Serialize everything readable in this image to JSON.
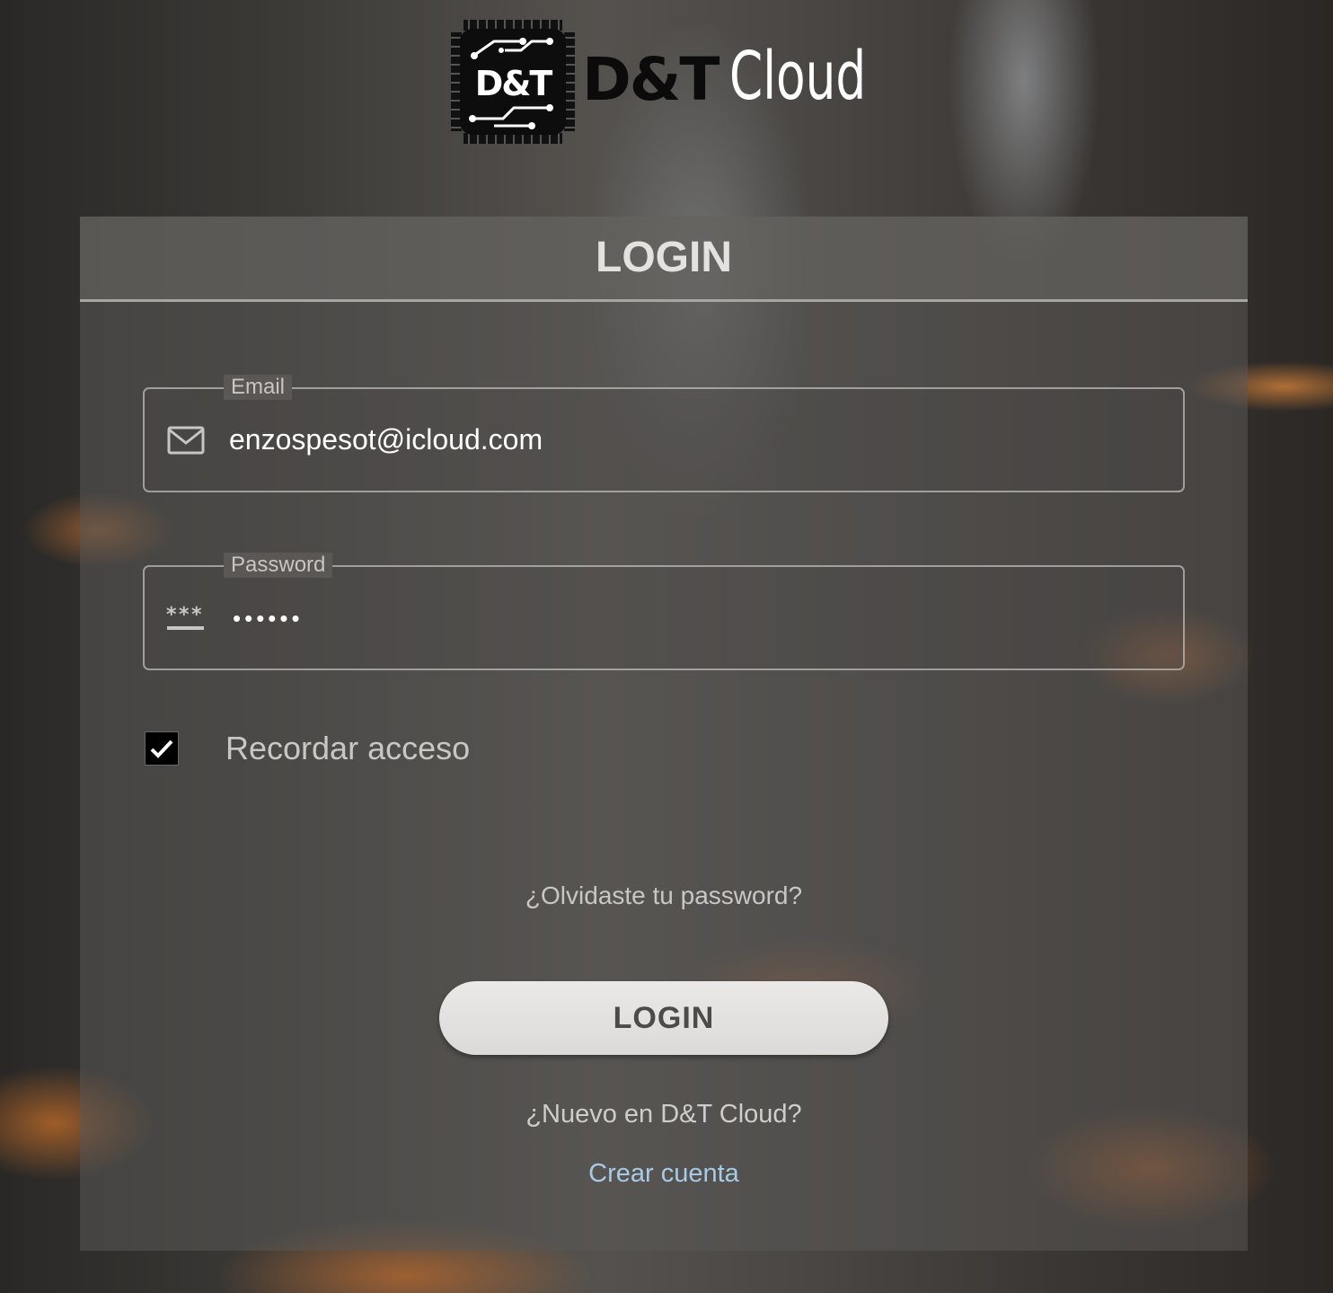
{
  "brand": {
    "logo_mark_text": "D&T",
    "name_bold": "D&T",
    "name_light": "Cloud"
  },
  "card": {
    "title": "LOGIN"
  },
  "email_field": {
    "label": "Email",
    "value": "enzospesot@icloud.com",
    "icon": "mail-icon"
  },
  "password_field": {
    "label": "Password",
    "masked_value": "••••••",
    "icon": "password-icon"
  },
  "remember": {
    "label": "Recordar acceso",
    "checked": true
  },
  "forgot_link": "¿Olvidaste tu password?",
  "login_button": "LOGIN",
  "signup": {
    "prompt": "¿Nuevo en D&T Cloud?",
    "link": "Crear cuenta"
  },
  "colors": {
    "link": "#a7cbe6",
    "button_bg": "#e5e3e2",
    "card_bg": "rgba(90,88,86,0.55)"
  }
}
